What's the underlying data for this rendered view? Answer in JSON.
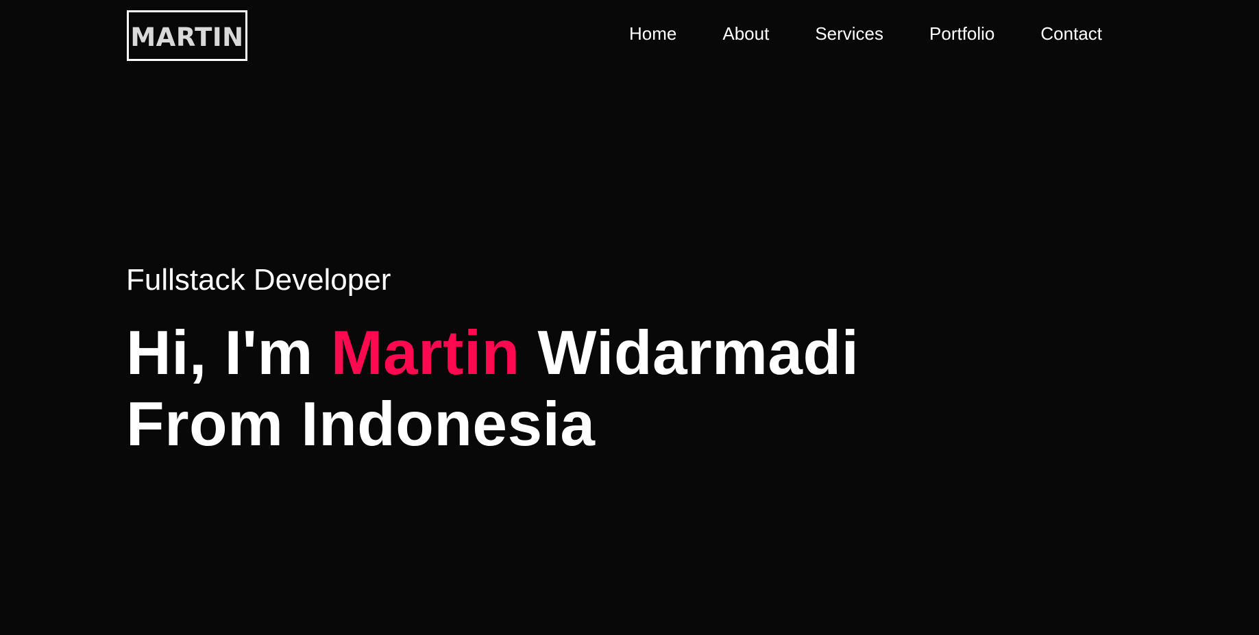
{
  "header": {
    "logo_text": "MARTIN",
    "nav": [
      {
        "label": "Home"
      },
      {
        "label": "About"
      },
      {
        "label": "Services"
      },
      {
        "label": "Portfolio"
      },
      {
        "label": "Contact"
      }
    ]
  },
  "hero": {
    "subtitle": "Fullstack Developer",
    "title": {
      "prefix": "Hi, I'm",
      "highlight": "Martin",
      "suffix": "Widarmadi",
      "line2": "From Indonesia"
    }
  },
  "colors": {
    "background": "#080808",
    "text": "#ffffff",
    "accent": "#ff0a50"
  }
}
